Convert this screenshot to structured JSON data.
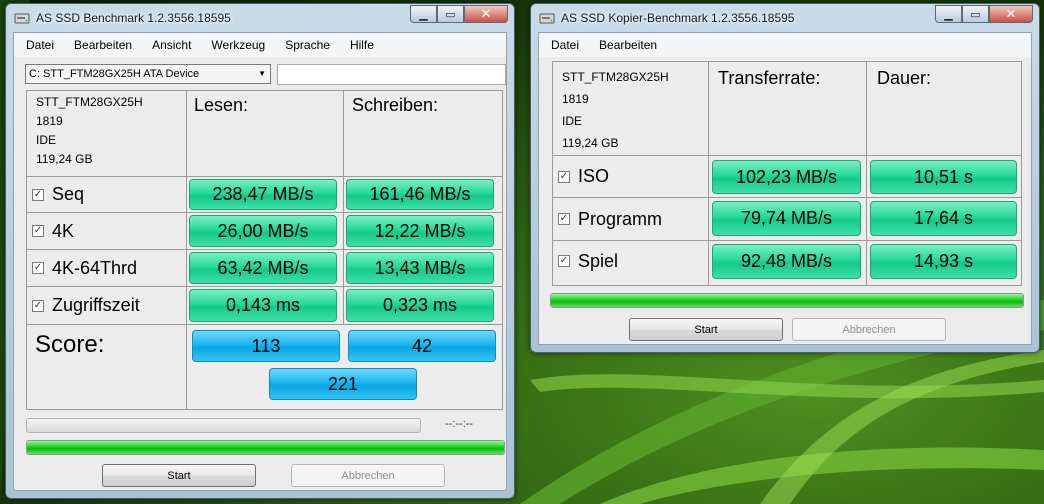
{
  "colors": {
    "value_green": "#26d89a",
    "score_blue": "#1bb6ee",
    "progress_green": "#1fcf1f"
  },
  "bench_window": {
    "title": "AS SSD Benchmark 1.2.3556.18595",
    "icon": "disk-icon",
    "menu": [
      "Datei",
      "Bearbeiten",
      "Ansicht",
      "Werkzeug",
      "Sprache",
      "Hilfe"
    ],
    "drive_select": "C: STT_FTM28GX25H ATA Device",
    "device_info": [
      "STT_FTM28GX25H",
      "1819",
      "IDE",
      "119,24 GB"
    ],
    "col_read": "Lesen:",
    "col_write": "Schreiben:",
    "rows": [
      {
        "label": "Seq",
        "checked": true,
        "read": "238,47 MB/s",
        "write": "161,46 MB/s"
      },
      {
        "label": "4K",
        "checked": true,
        "read": "26,00 MB/s",
        "write": "12,22 MB/s"
      },
      {
        "label": "4K-64Thrd",
        "checked": true,
        "read": "63,42 MB/s",
        "write": "13,43 MB/s"
      },
      {
        "label": "Zugriffszeit",
        "checked": true,
        "read": "0,143 ms",
        "write": "0,323 ms"
      }
    ],
    "score_label": "Score:",
    "score_read": "113",
    "score_write": "42",
    "score_total": "221",
    "progress_1": 0,
    "progress_2": 1,
    "time": "--:--:--",
    "start_label": "Start",
    "cancel_label": "Abbrechen"
  },
  "copy_window": {
    "title": "AS SSD Kopier-Benchmark 1.2.3556.18595",
    "icon": "disk-icon",
    "menu": [
      "Datei",
      "Bearbeiten"
    ],
    "device_info": [
      "STT_FTM28GX25H",
      "1819",
      "IDE",
      "119,24 GB"
    ],
    "col_rate": "Transferrate:",
    "col_duration": "Dauer:",
    "rows": [
      {
        "label": "ISO",
        "checked": true,
        "rate": "102,23 MB/s",
        "duration": "10,51 s"
      },
      {
        "label": "Programm",
        "checked": true,
        "rate": "79,74 MB/s",
        "duration": "17,64 s"
      },
      {
        "label": "Spiel",
        "checked": true,
        "rate": "92,48 MB/s",
        "duration": "14,93 s"
      }
    ],
    "progress": 1,
    "start_label": "Start",
    "cancel_label": "Abbrechen"
  }
}
